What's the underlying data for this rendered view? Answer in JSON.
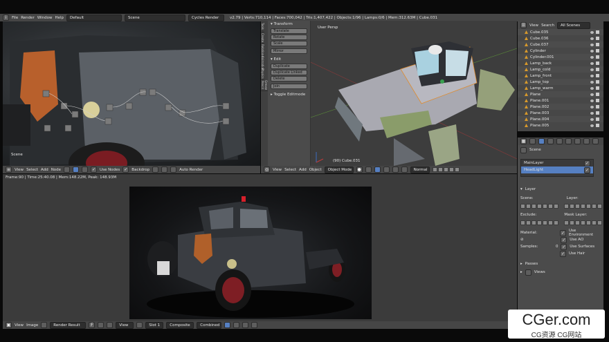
{
  "info_bar": {
    "menus": [
      "File",
      "Render",
      "Window",
      "Help"
    ],
    "layout_field": "Default",
    "scene_field": "Scene",
    "engine_field": "Cycles Render",
    "stats": "v2.79 | Verts:710,114 | Faces:700,042 | Tris:1,407,422 | Objects:1/96 | Lamps:0/6 | Mem:312.63M | Cube.031"
  },
  "node_editor": {
    "corner_label": "Scene",
    "header_items": [
      "View",
      "Select",
      "Add",
      "Node"
    ],
    "use_nodes": "Use Nodes",
    "backdrop": "Backdrop",
    "auto_render": "Auto Render"
  },
  "viewport": {
    "label": "User Persp",
    "object_label": "(90) Cube.031",
    "header_items": [
      "View",
      "Select",
      "Add",
      "Object"
    ],
    "mode": "Object Mode",
    "pivot": "Normal"
  },
  "tool_shelf": {
    "tabs": [
      "Tools",
      "Create",
      "Relations",
      "Animation",
      "Physics",
      "Grease Pencil"
    ],
    "transform_head": "Transform",
    "transform_buttons": [
      "Translate",
      "Rotate",
      "Scale",
      "Mirror"
    ],
    "edit_head": "Edit",
    "edit_buttons": [
      "Duplicate",
      "Duplicate Linked",
      "Delete",
      "Join"
    ],
    "toggle": "Toggle Editmode"
  },
  "outliner": {
    "header_items": [
      "View",
      "Search"
    ],
    "scenes_field": "All Scenes",
    "items": [
      "Cube.035",
      "Cube.036",
      "Cube.037",
      "Cylinder",
      "Cylinder.001",
      "Lamp_back",
      "Lamp_cold",
      "Lamp_front",
      "Lamp_top",
      "Lamp_warm",
      "Plane",
      "Plane.001",
      "Plane.002",
      "Plane.003",
      "Plane.004",
      "Plane.005"
    ]
  },
  "properties": {
    "scene_label": "Scene",
    "render_layers": [
      "MainLayer",
      "HeadLight"
    ],
    "layer_head": "Layer",
    "scene_col": "Scene:",
    "layer_col": "Layer:",
    "exclude_col": "Exclude:",
    "mask_col": "Mask Layer:",
    "material_label": "Material:",
    "samples_label": "Samples:",
    "samples_value": "0",
    "checks": [
      "Use Environment",
      "Use AO",
      "Use Surfaces",
      "Use Hair"
    ],
    "passes": "Passes",
    "views": "Views"
  },
  "image_editor": {
    "info": "Frame:90 | Time:25:40.08 | Mem:148.22M, Peak: 148.93M",
    "header_items": [
      "View",
      "Image"
    ],
    "image_field": "Render Result",
    "view_field": "View",
    "slot_field": "Slot 1",
    "layer_field": "Composite",
    "pass_field": "Combined"
  },
  "watermark": {
    "title": "CGer.com",
    "subtitle": "CG资源  CG网站"
  }
}
